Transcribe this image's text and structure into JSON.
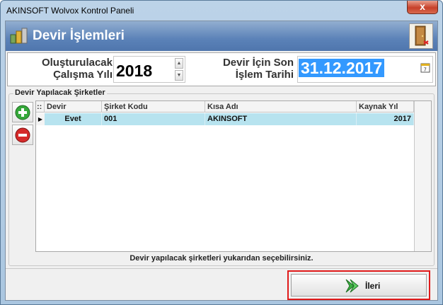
{
  "window": {
    "title": "AKINSOFT Wolvox Kontrol Paneli",
    "close_glyph": "x"
  },
  "banner": {
    "title": "Devir İşlemleri",
    "icon": "coins-icon",
    "exit_icon": "door-exit-icon"
  },
  "fields": {
    "year_label_1": "Oluşturulacak",
    "year_label_2": "Çalışma Yılı",
    "year_value": "2018",
    "date_label_1": "Devir İçin Son",
    "date_label_2": "İşlem Tarihi",
    "date_value": "31.12.2017"
  },
  "group": {
    "title": "Devir Yapılacak Şirketler",
    "columns": [
      "Devir",
      "Şirket Kodu",
      "Kısa Adı",
      "Kaynak Yıl"
    ],
    "header_marker": "::",
    "rows": [
      {
        "devir": "Evet",
        "kod": "001",
        "ad": "AKINSOFT",
        "yil": "2017"
      }
    ],
    "row_indicator": "▶",
    "hint": "Devir yapılacak şirketleri yukarıdan seçebilirsiniz."
  },
  "footer": {
    "next_label": "İleri"
  },
  "colors": {
    "banner": "#5b82b8",
    "row_selected": "#b7e3ef",
    "highlight": "#e01a1a",
    "date_selection": "#3399ff"
  }
}
